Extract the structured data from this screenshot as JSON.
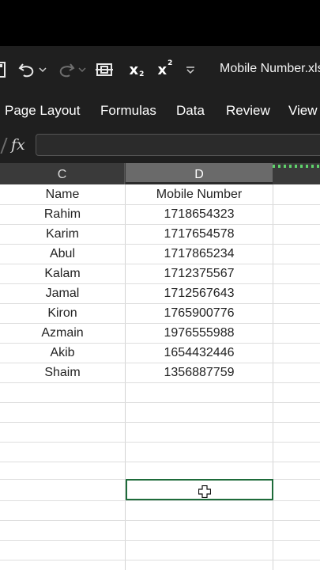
{
  "window": {
    "title": "Mobile Number.xlsx"
  },
  "quick_access": {
    "subscript_label": "x",
    "subscript_mark": "2",
    "superscript_label": "x",
    "superscript_mark": "2"
  },
  "ribbon": {
    "tabs": [
      {
        "label": "Page Layout"
      },
      {
        "label": "Formulas"
      },
      {
        "label": "Data"
      },
      {
        "label": "Review"
      },
      {
        "label": "View"
      }
    ]
  },
  "formula_bar": {
    "fx_label": "fx",
    "value": ""
  },
  "columns": {
    "c": "C",
    "d": "D"
  },
  "table": {
    "headers": {
      "name": "Name",
      "mobile": "Mobile Number"
    },
    "rows": [
      {
        "name": "Rahim",
        "mobile": "1718654323"
      },
      {
        "name": "Karim",
        "mobile": "1717654578"
      },
      {
        "name": "Abul",
        "mobile": "1717865234"
      },
      {
        "name": "Kalam",
        "mobile": "1712375567"
      },
      {
        "name": "Jamal",
        "mobile": "1712567643"
      },
      {
        "name": "Kiron",
        "mobile": "1765900776"
      },
      {
        "name": "Azmain",
        "mobile": "1976555988"
      },
      {
        "name": "Akib",
        "mobile": "1654432446"
      },
      {
        "name": "Shaim",
        "mobile": "1356887759"
      }
    ]
  },
  "colors": {
    "ribbon_bg": "#1f1f1f",
    "header_bg": "#3a3a3a",
    "selected_header_bg": "#6a6a6a",
    "selection_border": "#1e6b3a"
  },
  "icons": [
    "save-icon",
    "undo-icon",
    "redo-icon",
    "align-icon",
    "subscript-icon",
    "superscript-icon",
    "customize-qat-icon",
    "fill-cursor-icon"
  ]
}
